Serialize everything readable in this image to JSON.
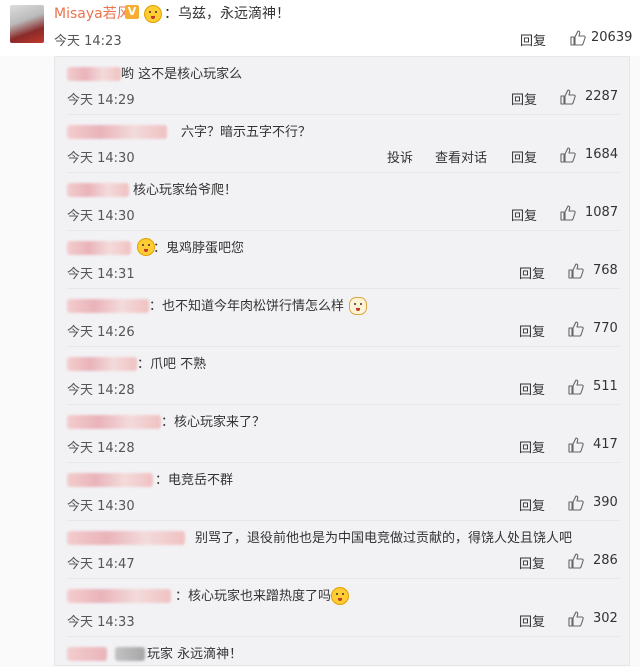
{
  "main": {
    "username": "Misaya若风",
    "badge": "V",
    "text": "：乌兹，永远滴神！",
    "time": "今天 14:23",
    "reply_label": "回复",
    "likes": "20639"
  },
  "replies": [
    {
      "text": "哟 这不是核心玩家么",
      "time": "今天 14:29",
      "reply_label": "回复",
      "likes": "2287"
    },
    {
      "text": "六字？暗示五字不行？",
      "time": "今天 14:30",
      "report_label": "投诉",
      "convo_label": "查看对话",
      "reply_label": "回复",
      "likes": "1684"
    },
    {
      "text": "核心玩家给爷爬！",
      "time": "今天 14:30",
      "reply_label": "回复",
      "likes": "1087"
    },
    {
      "text": "：鬼鸡脖蛋吧您",
      "time": "今天 14:31",
      "reply_label": "回复",
      "likes": "768"
    },
    {
      "text": "：也不知道今年肉松饼行情怎么样",
      "time": "今天 14:26",
      "reply_label": "回复",
      "likes": "770"
    },
    {
      "text": "：爪吧 不熟",
      "time": "今天 14:28",
      "reply_label": "回复",
      "likes": "511"
    },
    {
      "text": "：核心玩家来了？",
      "time": "今天 14:28",
      "reply_label": "回复",
      "likes": "417"
    },
    {
      "text": "：电竞岳不群",
      "time": "今天 14:30",
      "reply_label": "回复",
      "likes": "390"
    },
    {
      "text": "别骂了，退役前他也是为中国电竞做过贡献的，得饶人处且饶人吧",
      "time": "今天 14:47",
      "reply_label": "回复",
      "likes": "286"
    },
    {
      "text": "：核心玩家也来蹭热度了吗",
      "time": "今天 14:33",
      "reply_label": "回复",
      "likes": "302"
    },
    {
      "text": "玩家 永远滴神！"
    }
  ]
}
